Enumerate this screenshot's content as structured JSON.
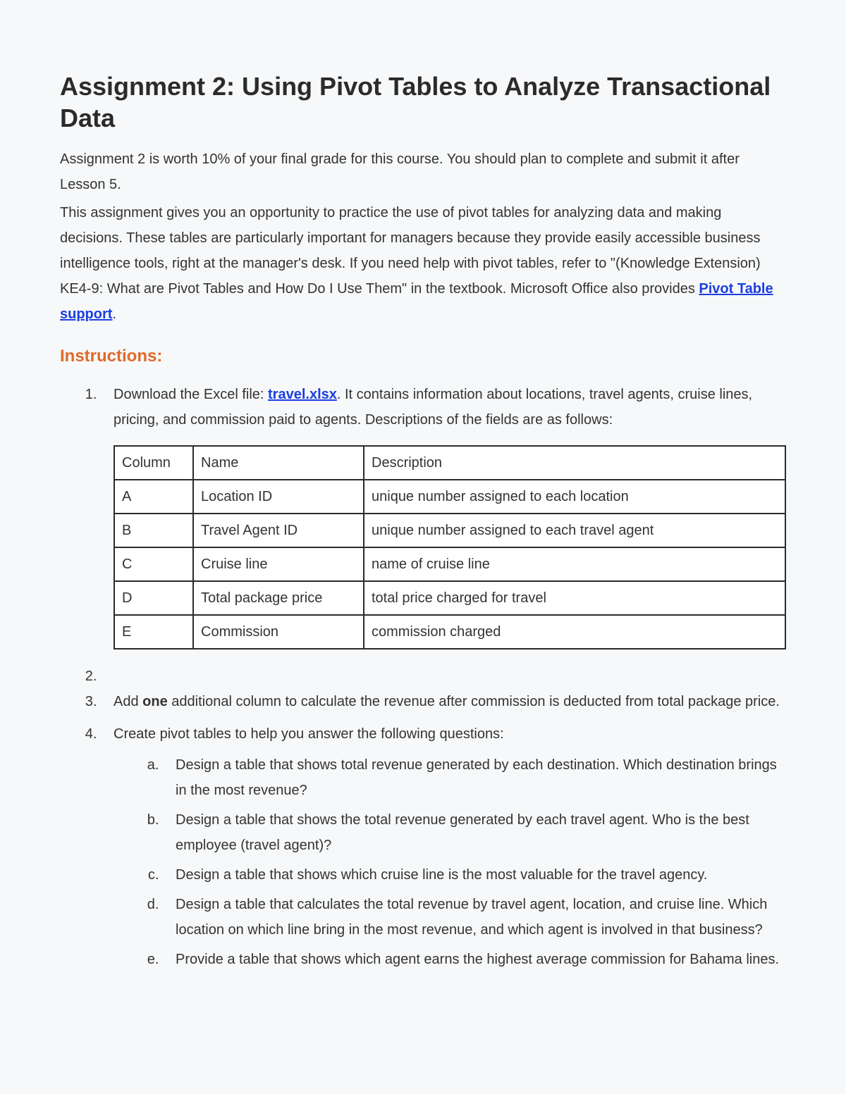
{
  "title": "Assignment 2: Using Pivot Tables to Analyze Transactional Data",
  "intro": {
    "p1": "Assignment 2 is worth 10% of your final grade for this course. You should plan to complete and submit it after Lesson 5.",
    "p2a": "This assignment gives you an opportunity to practice the use of pivot tables for analyzing data and making decisions. These tables are particularly important for managers because they provide easily accessible business intelligence tools, right at the manager's desk. If you need help with pivot tables, refer to \"(Knowledge Extension) KE4-9: What are Pivot Tables and How Do I Use Them\" in the textbook. Microsoft Office also provides ",
    "link1": "Pivot Table support",
    "p2b": "."
  },
  "instructions_heading": "Instructions:",
  "step1": {
    "pre": "Download the Excel file: ",
    "link": "travel.xlsx",
    "post": ". It contains information about locations, travel agents, cruise lines, pricing, and commission paid to agents. Descriptions of the fields are as follows:"
  },
  "table": {
    "header": {
      "c": "Column",
      "n": "Name",
      "d": "Description"
    },
    "rows": [
      {
        "c": "A",
        "n": "Location ID",
        "d": "unique number assigned to each location"
      },
      {
        "c": "B",
        "n": "Travel Agent ID",
        "d": "unique number assigned to each travel agent"
      },
      {
        "c": "C",
        "n": "Cruise line",
        "d": "name of cruise line"
      },
      {
        "c": "D",
        "n": "Total package price",
        "d": "total price charged for travel"
      },
      {
        "c": "E",
        "n": "Commission",
        "d": "commission charged"
      }
    ]
  },
  "step2": "",
  "step3": {
    "pre": "Add ",
    "bold": "one",
    "post": " additional column to calculate the revenue after commission is deducted from total package price."
  },
  "step4": {
    "lead": "Create pivot tables to help you answer the following questions:",
    "subs": {
      "a": "Design a table that shows total revenue generated by each destination. Which destination brings in the most revenue?",
      "b": "Design a table that shows the total revenue generated by each travel agent. Who is the best employee (travel agent)?",
      "c": "Design a table that shows which cruise line is the most valuable for the travel agency.",
      "d": "Design a table that calculates the total revenue by travel agent, location, and cruise line. Which location on which line bring in the most revenue, and which agent is involved in that business?",
      "e": "Provide a table that shows which agent earns the highest average commission for Bahama lines."
    }
  }
}
